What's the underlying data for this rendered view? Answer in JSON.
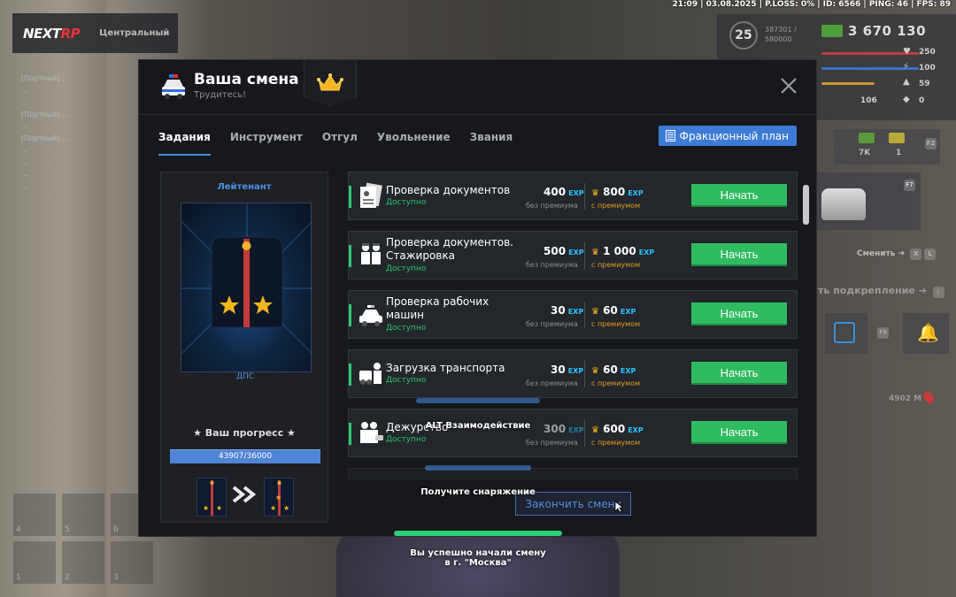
{
  "statusbar": "21:09 | 03.08.2025 | P.LOSS: 0% | ID: 6566 | PING: 46 | FPS: 89",
  "server": {
    "logo_a": "NEXT",
    "logo_b": "RP",
    "name": "Центральный"
  },
  "chat": [
    "[Портный] ...",
    "...",
    "...",
    "[Портный] ...",
    "...",
    "[Портный] ...",
    "...",
    "...",
    "...",
    "..."
  ],
  "hud": {
    "level": "25",
    "exp_line1": "387301 /",
    "exp_line2": "580000",
    "money": "3 670 130",
    "health": "250",
    "armor": "100",
    "hunger": "59",
    "stat_a": "106",
    "stat_b": "0",
    "f2_key": "F2",
    "f7_key": "F7",
    "f9_key": "F9",
    "ammo_a": "7K",
    "ammo_b": "1",
    "change_label": "Сменить",
    "reinforce_label": "ть подкрепление",
    "key_x": "X",
    "key_l": "L",
    "distance": "4902 M"
  },
  "modal": {
    "title": "Ваша смена",
    "subtitle": "Трудитесь!",
    "tabs": [
      {
        "label": "Задания",
        "active": true
      },
      {
        "label": "Инструмент",
        "active": false
      },
      {
        "label": "Отгул",
        "active": false
      },
      {
        "label": "Увольнение",
        "active": false
      },
      {
        "label": "Звания",
        "active": false
      }
    ],
    "faction_plan_label": "Фракционный план",
    "end_shift_label": "Закончить смену"
  },
  "rank": {
    "name": "Лейтенант",
    "department": "ДПС",
    "progress_label": "★ Ваш прогресс ★",
    "progress_text": "43907/36000"
  },
  "tasks": [
    {
      "name": "Проверка документов",
      "status": "Доступно",
      "exp": "400",
      "exp_premium": "800",
      "button": "Начать",
      "icon": "document-check-icon"
    },
    {
      "name": "Проверка документов. Стажировка",
      "status": "Доступно",
      "exp": "500",
      "exp_premium": "1 000",
      "button": "Начать",
      "icon": "trainee-officers-icon"
    },
    {
      "name": "Проверка рабочих машин",
      "status": "Доступно",
      "exp": "30",
      "exp_premium": "60",
      "button": "Начать",
      "icon": "police-car-icon"
    },
    {
      "name": "Загрузка транспорта",
      "status": "Доступно",
      "exp": "30",
      "exp_premium": "60",
      "button": "Начать",
      "icon": "tow-transport-icon"
    },
    {
      "name": "Дежурство",
      "status": "Доступно",
      "exp": "300",
      "exp_premium": "600",
      "button": "Начать",
      "icon": "duty-officers-icon"
    }
  ],
  "labels": {
    "exp_tag": "EXP",
    "no_premium": "без премиума",
    "with_premium": "с премиумом"
  },
  "overlays": {
    "interact": "ALT Взаимодействие",
    "equipment": "Получите снаряжение",
    "notice_line1": "Вы успешно начали смену",
    "notice_line2": "в г. \"Москва\""
  },
  "inventory_slots": [
    "4",
    "5",
    "6",
    "1",
    "2",
    "3"
  ],
  "colors": {
    "accent_blue": "#3d7bd6",
    "start_green": "#2fbb5f",
    "status_green": "#27c469",
    "exp_cyan": "#29c3ff",
    "premium_orange": "#e79a22"
  }
}
